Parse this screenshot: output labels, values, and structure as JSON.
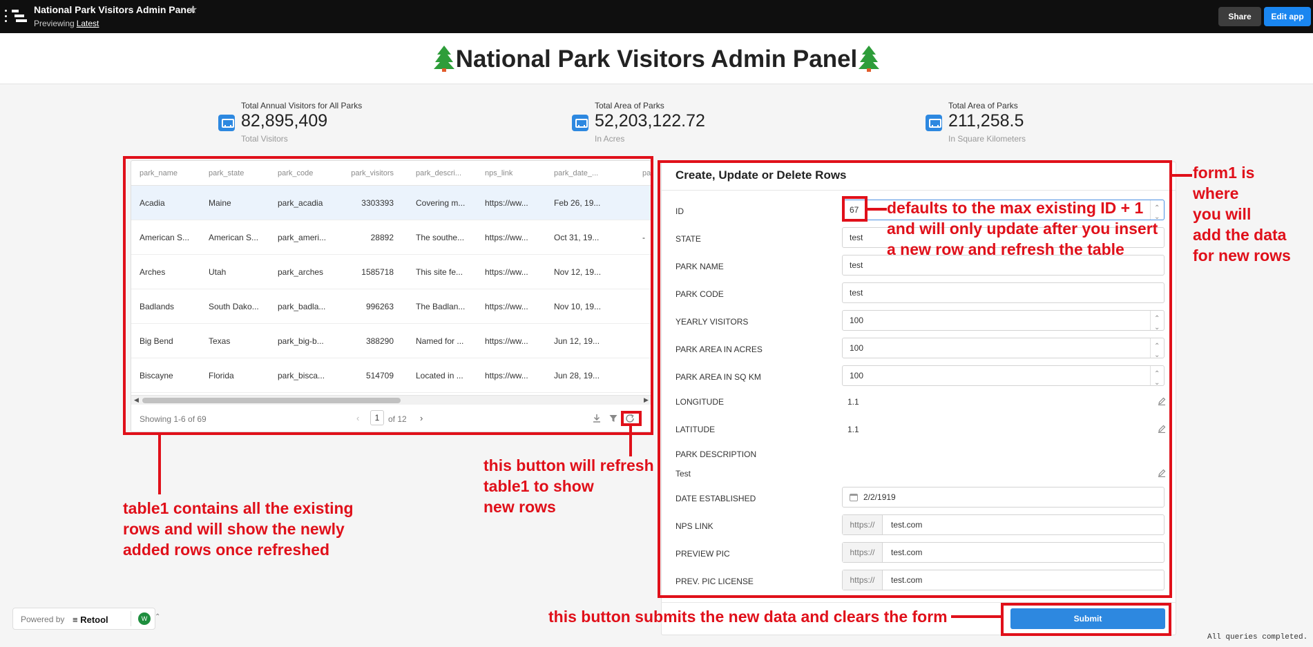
{
  "topbar": {
    "title": "National Park Visitors Admin Panel",
    "previewing": "Previewing",
    "version": "Latest",
    "share_label": "Share",
    "edit_label": "Edit app"
  },
  "header": {
    "title": "National Park Visitors Admin Panel"
  },
  "stats": [
    {
      "label": "Total Annual Visitors for All Parks",
      "value": "82,895,409",
      "sub": "Total Visitors"
    },
    {
      "label": "Total Area of Parks",
      "value": "52,203,122.72",
      "sub": "In Acres"
    },
    {
      "label": "Total Area of Parks",
      "value": "211,258.5",
      "sub": "In Square Kilometers"
    }
  ],
  "table": {
    "columns": [
      "park_name",
      "park_state",
      "park_code",
      "park_visitors",
      "park_descri...",
      "nps_link",
      "park_date_...",
      "pa"
    ],
    "rows": [
      [
        "Acadia",
        "Maine",
        "park_acadia",
        "3303393",
        "Covering m...",
        "https://ww...",
        "Feb 26, 19...",
        ""
      ],
      [
        "American S...",
        "American S...",
        "park_ameri...",
        "28892",
        "The southe...",
        "https://ww...",
        "Oct 31, 19...",
        "-"
      ],
      [
        "Arches",
        "Utah",
        "park_arches",
        "1585718",
        "This site fe...",
        "https://ww...",
        "Nov 12, 19...",
        ""
      ],
      [
        "Badlands",
        "South Dako...",
        "park_badla...",
        "996263",
        "The Badlan...",
        "https://ww...",
        "Nov 10, 19...",
        ""
      ],
      [
        "Big Bend",
        "Texas",
        "park_big-b...",
        "388290",
        "Named for ...",
        "https://ww...",
        "Jun 12, 19...",
        ""
      ],
      [
        "Biscayne",
        "Florida",
        "park_bisca...",
        "514709",
        "Located in ...",
        "https://ww...",
        "Jun 28, 19...",
        ""
      ]
    ],
    "showing": "Showing 1-6 of 69",
    "page": "1",
    "of_pages": "of 12"
  },
  "form": {
    "title": "Create, Update or Delete Rows",
    "fields": {
      "id": {
        "label": "ID",
        "value": "67"
      },
      "state": {
        "label": "STATE",
        "value": "test"
      },
      "park_name": {
        "label": "PARK NAME",
        "value": "test"
      },
      "park_code": {
        "label": "PARK CODE",
        "value": "test"
      },
      "yearly_visitors": {
        "label": "YEARLY VISITORS",
        "value": "100"
      },
      "area_acres": {
        "label": "PARK AREA IN ACRES",
        "value": "100"
      },
      "area_sqkm": {
        "label": "PARK AREA IN SQ KM",
        "value": "100"
      },
      "longitude": {
        "label": "LONGITUDE",
        "value": "1.1"
      },
      "latitude": {
        "label": "LATITUDE",
        "value": "1.1"
      },
      "description": {
        "label": "PARK DESCRIPTION",
        "value": "Test"
      },
      "date_established": {
        "label": "DATE ESTABLISHED",
        "value": "2/2/1919"
      },
      "nps_link": {
        "label": "NPS LINK",
        "prefix": "https://",
        "value": "test.com"
      },
      "preview_pic": {
        "label": "PREVIEW PIC",
        "prefix": "https://",
        "value": "test.com"
      },
      "pic_license": {
        "label": "PREV. PIC LICENSE",
        "prefix": "https://",
        "value": "test.com"
      }
    },
    "submit_label": "Submit"
  },
  "annotations": {
    "id_note": [
      "defaults to the max existing ID + 1",
      "and will only update after you insert",
      "a new row and refresh the table"
    ],
    "form_note": [
      "form1 is",
      "where",
      "you will",
      "add the data",
      "for new rows"
    ],
    "refresh_note": [
      "this button will refresh",
      "table1 to show",
      "new rows"
    ],
    "table_note": [
      "table1 contains all the existing",
      "rows and will show the newly",
      "added rows once refreshed"
    ],
    "submit_note": "this button submits the new data and clears the form"
  },
  "footer": {
    "powered_by": "Powered by",
    "brand": "Retool",
    "avatar": "W",
    "status": "All queries completed."
  },
  "colors": {
    "accent": "#2d88e0",
    "annotation": "#e0101a",
    "topbar": "#0f0f0f"
  }
}
